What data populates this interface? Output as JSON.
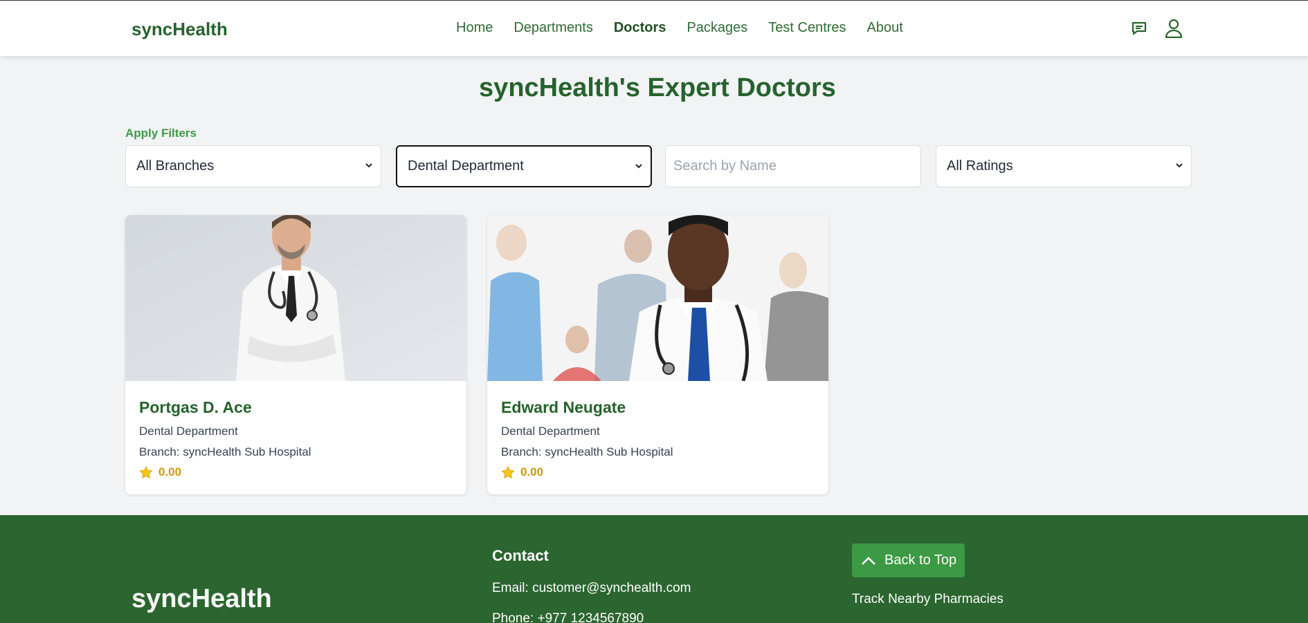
{
  "header": {
    "brand": "syncHealth",
    "nav": [
      "Home",
      "Departments",
      "Doctors",
      "Packages",
      "Test Centres",
      "About"
    ],
    "active_nav": "Doctors",
    "icons": [
      "chat-icon",
      "user-icon"
    ]
  },
  "main": {
    "title": "syncHealth's Expert Doctors",
    "filters_label": "Apply Filters",
    "filters": {
      "branch": "All Branches",
      "department": "Dental Department",
      "search_placeholder": "Search by Name",
      "rating": "All Ratings"
    },
    "doctors": [
      {
        "name": "Portgas D. Ace",
        "department": "Dental Department",
        "branch": "Branch: syncHealth Sub Hospital",
        "rating": "0.00"
      },
      {
        "name": "Edward Neugate",
        "department": "Dental Department",
        "branch": "Branch: syncHealth Sub Hospital",
        "rating": "0.00"
      }
    ]
  },
  "footer": {
    "brand": "syncHealth",
    "contact_title": "Contact",
    "email": "Email: customer@synchealth.com",
    "phone": "Phone: +977 1234567890",
    "back_to_top": "Back to Top",
    "pharmacies": "Track Nearby Pharmacies"
  },
  "colors": {
    "brand_green": "#25632c",
    "footer_green": "#2b652f",
    "button_green": "#3b9a43",
    "rating_gold": "#c99a0c"
  }
}
